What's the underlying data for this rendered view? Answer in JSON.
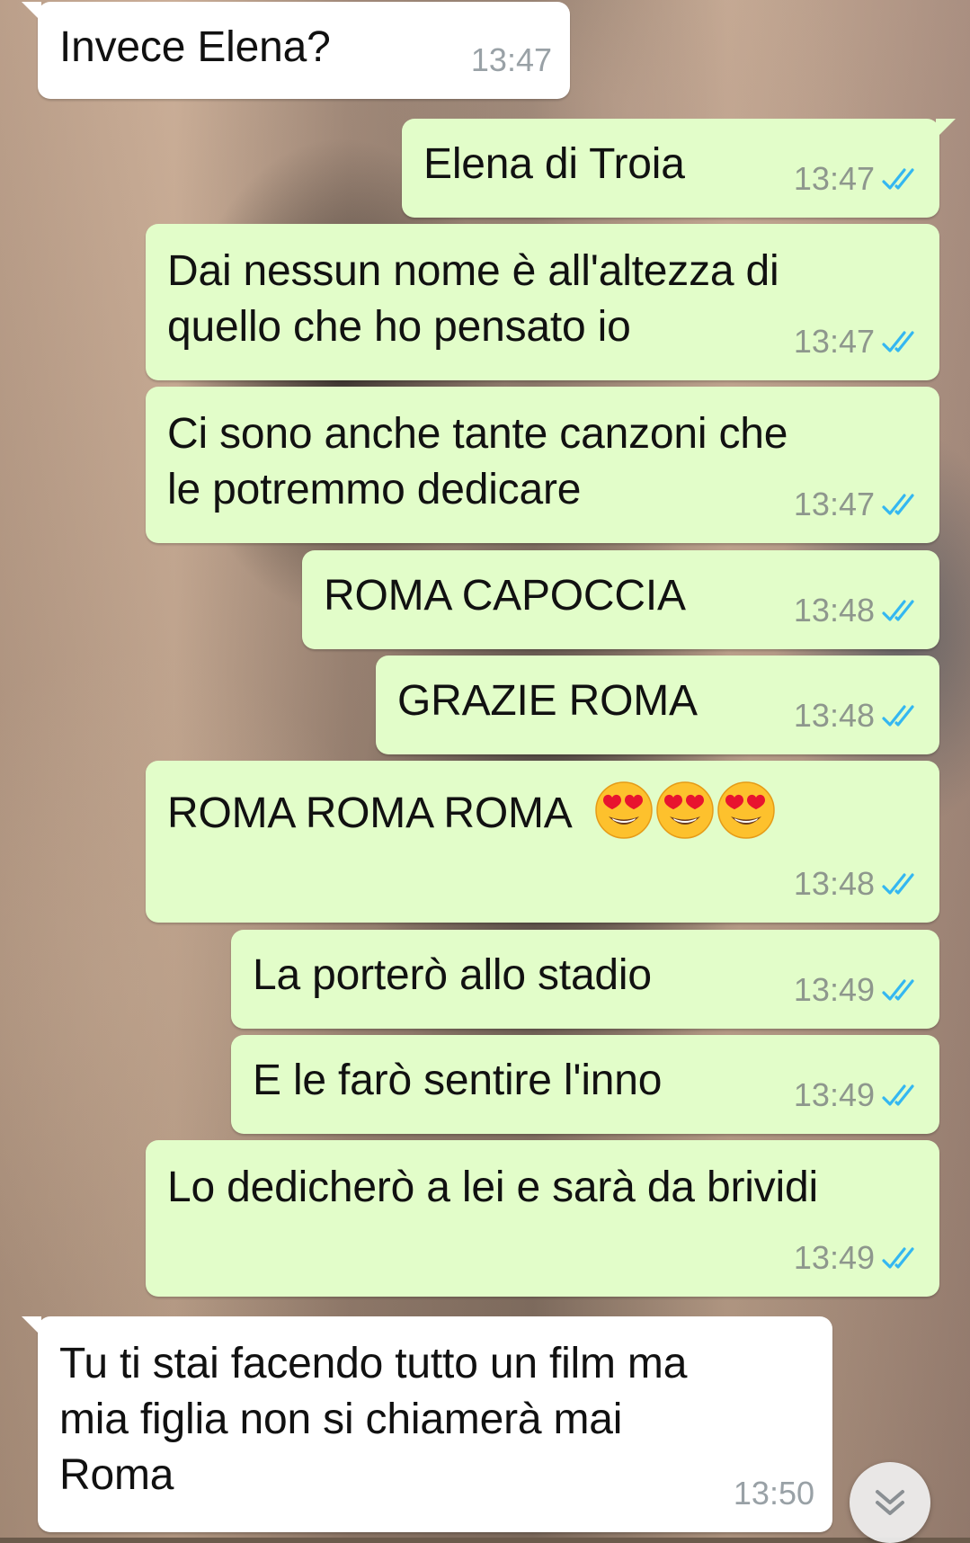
{
  "messages": [
    {
      "direction": "in",
      "text": "Invece Elena?",
      "time": "13:47"
    },
    {
      "direction": "out",
      "text": "Elena di Troia",
      "time": "13:47",
      "status": "read"
    },
    {
      "direction": "out",
      "text": "Dai nessun nome è all'altezza di\nquello che ho pensato io",
      "time": "13:47",
      "status": "read"
    },
    {
      "direction": "out",
      "text": "Ci sono anche tante canzoni che\nle potremmo dedicare",
      "time": "13:47",
      "status": "read"
    },
    {
      "direction": "out",
      "text": "ROMA CAPOCCIA",
      "time": "13:48",
      "status": "read"
    },
    {
      "direction": "out",
      "text": "GRAZIE ROMA",
      "time": "13:48",
      "status": "read"
    },
    {
      "direction": "out",
      "text": "ROMA ROMA ROMA",
      "emoji": [
        "heart-eyes",
        "heart-eyes",
        "heart-eyes"
      ],
      "time": "13:48",
      "status": "read"
    },
    {
      "direction": "out",
      "text": "La porterò allo stadio",
      "time": "13:49",
      "status": "read"
    },
    {
      "direction": "out",
      "text": "E le farò sentire l'inno",
      "time": "13:49",
      "status": "read"
    },
    {
      "direction": "out",
      "text": "Lo dedicherò a lei e sarà da brividi",
      "time": "13:49",
      "status": "read"
    },
    {
      "direction": "in",
      "text": "Tu ti stai facendo tutto un film ma\nmia figlia non si chiamerà mai\nRoma",
      "time": "13:50"
    }
  ],
  "scroll_button": {
    "icon": "double-chevron-down-icon"
  },
  "colors": {
    "incoming_bubble": "#ffffff",
    "outgoing_bubble": "#e2fdc9",
    "read_ticks": "#34b7f1",
    "timestamp": "#8e978d"
  }
}
